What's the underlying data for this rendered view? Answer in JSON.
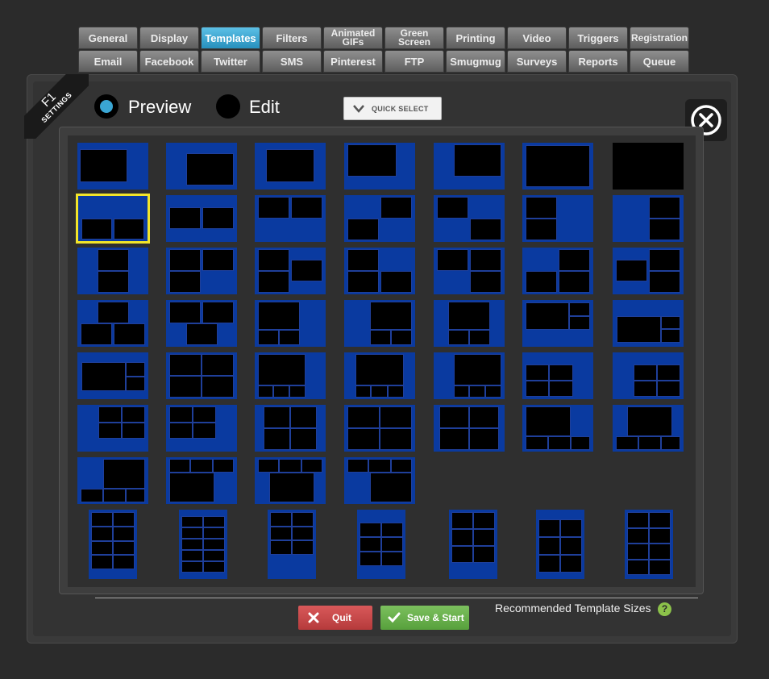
{
  "tabs_row1": [
    "General",
    "Display",
    "Templates",
    "Filters",
    "Animated\nGIFs",
    "Green\nScreen",
    "Printing",
    "Video",
    "Triggers",
    "Registration"
  ],
  "tabs_row2": [
    "Email",
    "Facebook",
    "Twitter",
    "SMS",
    "Pinterest",
    "FTP",
    "Smugmug",
    "Surveys",
    "Reports",
    "Queue"
  ],
  "active_tab": "Templates",
  "ribbon": {
    "key": "F1",
    "label": "SETTINGS"
  },
  "mode": {
    "preview_label": "Preview",
    "edit_label": "Edit",
    "selected": "Preview"
  },
  "quick_select": "QUICK SELECT",
  "buttons": {
    "quit": "Quit",
    "save_start": "Save & Start"
  },
  "recommended": "Recommended Template Sizes",
  "help": "?",
  "colors": {
    "template_bg": "#0a3aa0",
    "selected_outline": "#f2e52a",
    "active_tab": "#2f9cc8",
    "quit": "#c94849",
    "save": "#68b04a"
  },
  "selected_template": 7,
  "template_count": 53
}
